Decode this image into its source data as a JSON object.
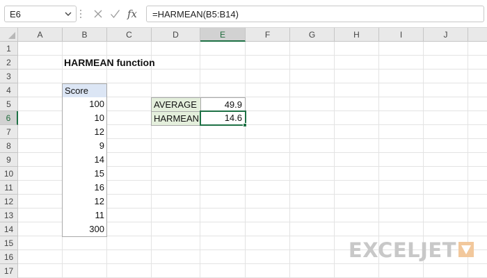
{
  "formula_bar": {
    "name_box": "E6",
    "formula": "=HARMEAN(B5:B14)"
  },
  "icons": [
    "chevron-down-icon",
    "cancel-icon",
    "enter-icon",
    "fx-icon"
  ],
  "columns": [
    "A",
    "B",
    "C",
    "D",
    "E",
    "F",
    "G",
    "H",
    "I",
    "J"
  ],
  "selected_column": "E",
  "rows": [
    "1",
    "2",
    "3",
    "4",
    "5",
    "6",
    "7",
    "8",
    "9",
    "10",
    "11",
    "12",
    "13",
    "14",
    "15",
    "16",
    "17"
  ],
  "selected_row": "6",
  "sheet": {
    "title": "HARMEAN function",
    "score_header": "Score",
    "scores": [
      "100",
      "10",
      "12",
      "9",
      "14",
      "15",
      "16",
      "12",
      "11",
      "300"
    ],
    "summary": [
      {
        "label": "AVERAGE",
        "value": "49.9"
      },
      {
        "label": "HARMEAN",
        "value": "14.6"
      }
    ]
  },
  "watermark": "EXCELJET",
  "colors": {
    "accent": "#1e7145",
    "score_header_bg": "#dce6f5",
    "label_bg": "#e4efdc",
    "watermark": "#c8c8c8"
  }
}
